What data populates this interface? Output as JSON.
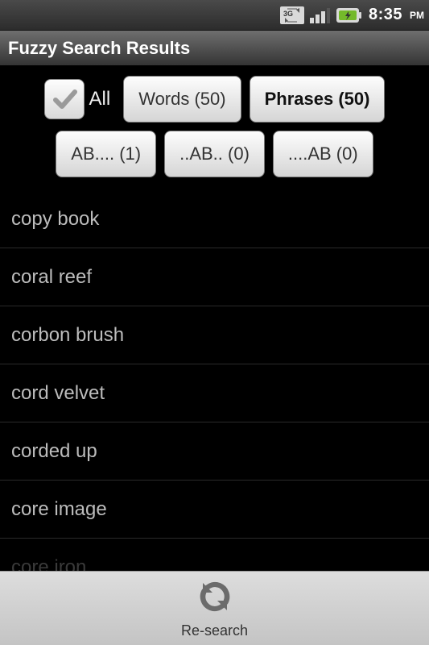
{
  "status": {
    "time": "8:35",
    "ampm": "PM"
  },
  "title": "Fuzzy Search Results",
  "filters": {
    "all_label": "All",
    "all_checked": true,
    "row1": [
      {
        "label": "Words (50)",
        "bold": false
      },
      {
        "label": "Phrases (50)",
        "bold": true
      }
    ],
    "row2": [
      {
        "label": "AB.... (1)"
      },
      {
        "label": "..AB.. (0)"
      },
      {
        "label": "....AB (0)"
      }
    ]
  },
  "results": [
    "copy book",
    "coral reef",
    "corbon brush",
    "cord velvet",
    "corded up",
    "core image",
    "core iron"
  ],
  "bottom": {
    "research_label": "Re-search"
  }
}
